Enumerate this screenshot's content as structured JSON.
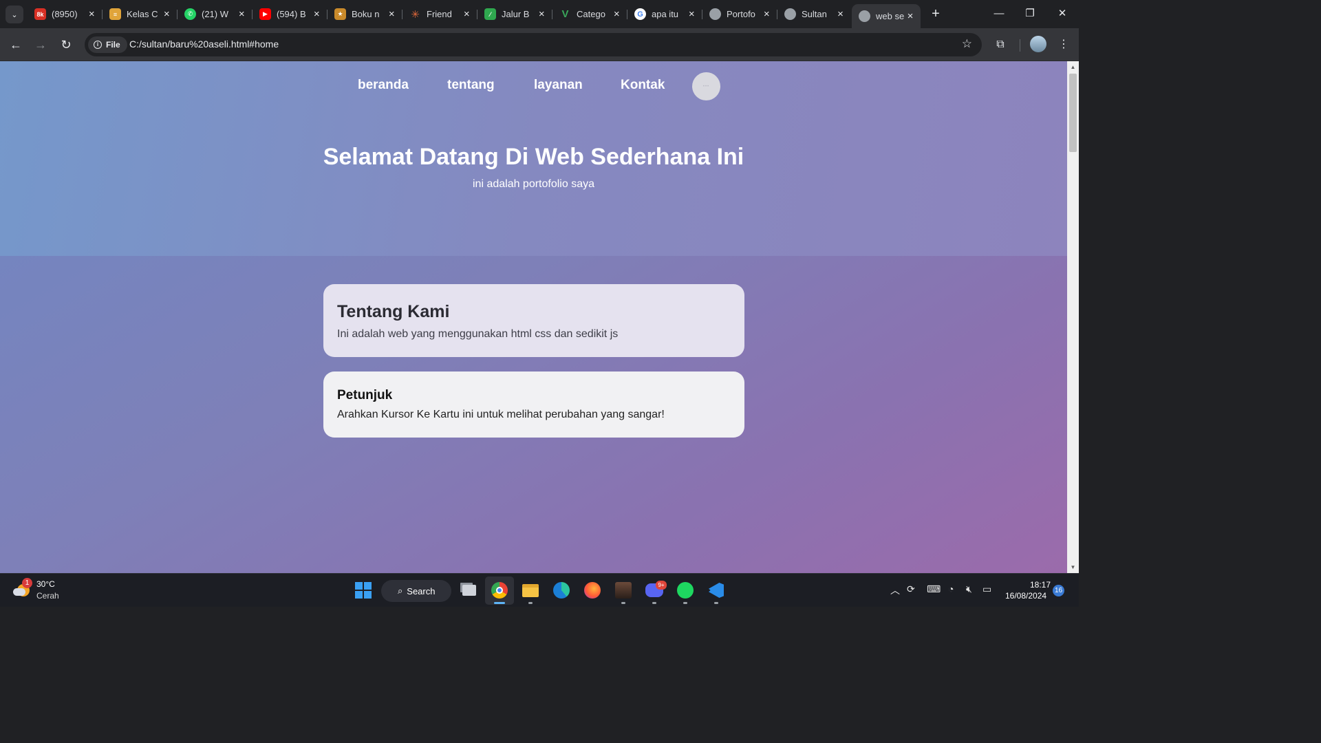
{
  "browser": {
    "tabs": [
      {
        "title": "(8950)",
        "favicon": "mail-icon",
        "color": "#d93025"
      },
      {
        "title": "Kelas C",
        "favicon": "book-stack-icon",
        "color": "#e0a43a"
      },
      {
        "title": "(21) W",
        "favicon": "whatsapp-icon",
        "color": "#25d366"
      },
      {
        "title": "(594) B",
        "favicon": "youtube-icon",
        "color": "#ff0000"
      },
      {
        "title": "Boku n",
        "favicon": "manga-icon",
        "color": "#c98a2b"
      },
      {
        "title": "Friend",
        "favicon": "spark-icon",
        "color": "#e0683a"
      },
      {
        "title": "Jalur B",
        "favicon": "sheet-icon",
        "color": "#2fa84f"
      },
      {
        "title": "Catego",
        "favicon": "v-icon",
        "color": "#3aa65a"
      },
      {
        "title": "apa itu",
        "favicon": "google-icon",
        "color": "#4285f4"
      },
      {
        "title": "Portofo",
        "favicon": "globe-icon",
        "color": "#9aa0a6"
      },
      {
        "title": "Sultan",
        "favicon": "globe-icon",
        "color": "#9aa0a6"
      },
      {
        "title": "web se",
        "favicon": "globe-icon",
        "color": "#9aa0a6"
      }
    ],
    "active_tab": 11,
    "site_chip": "File",
    "url": "C:/sultan/baru%20aseli.html#home"
  },
  "page": {
    "nav": [
      "beranda",
      "tentang",
      "layanan",
      "Kontak"
    ],
    "hero_title": "Selamat Datang Di Web Sederhana Ini",
    "hero_subtitle": "ini adalah portofolio saya",
    "cards": [
      {
        "title": "Tentang Kami",
        "text": "Ini adalah web yang menggunakan html css dan sedikit js"
      },
      {
        "title": "Petunjuk",
        "text": "Arahkan Kursor Ke Kartu ini untuk melihat perubahan yang sangar!"
      }
    ]
  },
  "taskbar": {
    "weather_badge": "1",
    "temperature": "30°C",
    "condition": "Cerah",
    "search_label": "Search",
    "discord_badge": "9+",
    "time": "18:17",
    "date": "16/08/2024",
    "notification_count": "16"
  }
}
